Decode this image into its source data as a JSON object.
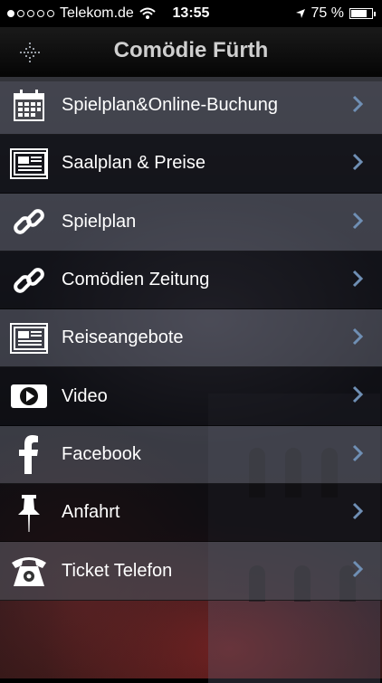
{
  "status_bar": {
    "carrier": "Telekom.de",
    "signal_dots_filled": 1,
    "signal_dots_total": 5,
    "time": "13:55",
    "battery_percent": "75 %",
    "battery_level": 0.75
  },
  "navbar": {
    "title": "Comödie Fürth",
    "menu_icon": "menu-icon"
  },
  "menu": {
    "items": [
      {
        "label": "Spielplan&Online-Buchung",
        "icon": "calendar-icon"
      },
      {
        "label": "Saalplan & Preise",
        "icon": "newspaper-icon"
      },
      {
        "label": "Spielplan",
        "icon": "link-icon"
      },
      {
        "label": "Comödien Zeitung",
        "icon": "link-icon"
      },
      {
        "label": "Reiseangebote",
        "icon": "newspaper-icon"
      },
      {
        "label": "Video",
        "icon": "video-icon"
      },
      {
        "label": "Facebook",
        "icon": "facebook-icon"
      },
      {
        "label": "Anfahrt",
        "icon": "pin-icon"
      },
      {
        "label": "Ticket Telefon",
        "icon": "telephone-icon"
      }
    ],
    "chevron_icon": "chevron-right-icon",
    "chevron_color": "#6f8fb4"
  }
}
